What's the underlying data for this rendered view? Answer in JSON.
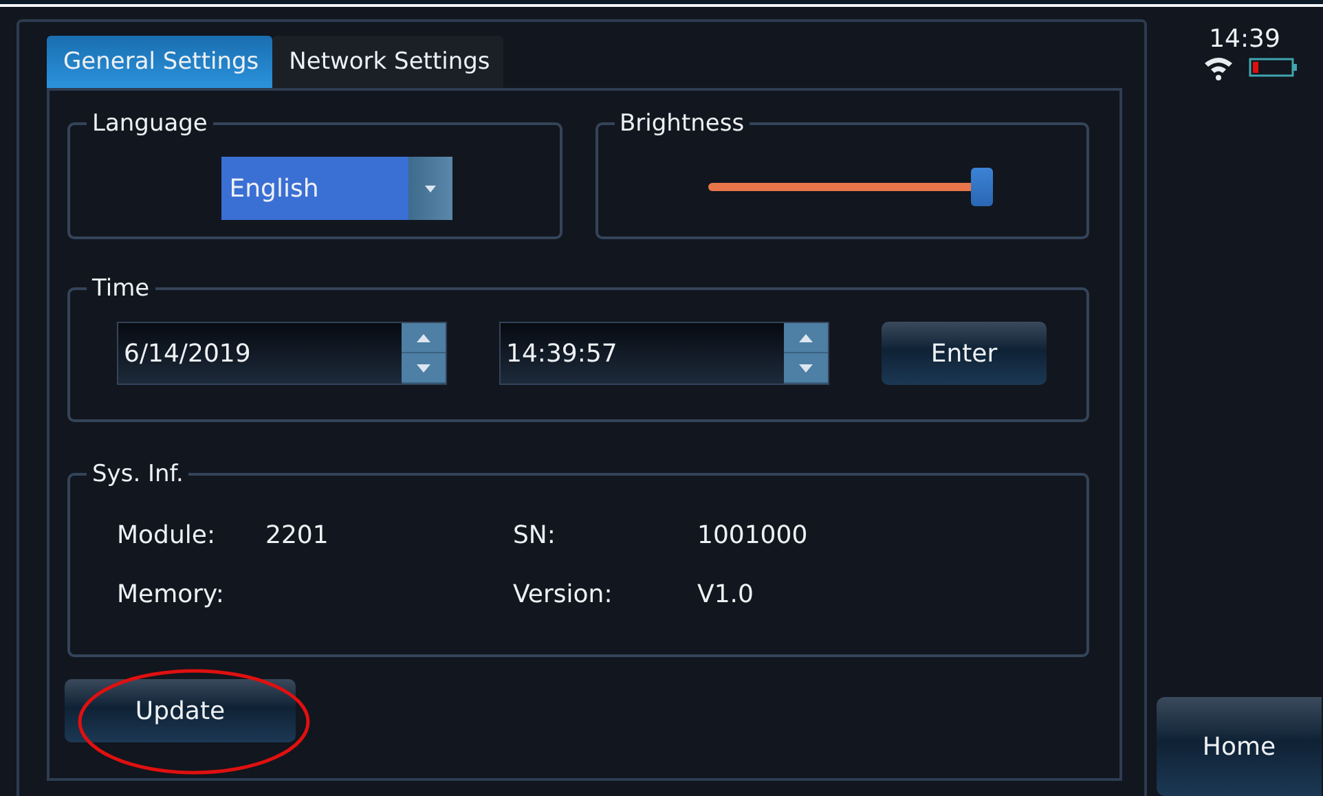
{
  "tabs": [
    {
      "label": "General Settings",
      "selected": true
    },
    {
      "label": "Network Settings",
      "selected": false
    }
  ],
  "language": {
    "title": "Language",
    "value": "English"
  },
  "brightness": {
    "title": "Brightness",
    "level": 0.97
  },
  "time": {
    "title": "Time",
    "date": "6/14/2019",
    "clock": "14:39:57",
    "button": "Enter"
  },
  "system_info": {
    "title": "Sys. Inf.",
    "fields": [
      {
        "label": "Module:",
        "value": "2201"
      },
      {
        "label": "SN:",
        "value": "1001000"
      },
      {
        "label": "Memory:"
      },
      {
        "label": "Version:",
        "value": "V1.0"
      }
    ]
  },
  "update_button": {
    "label": "Update",
    "highlighted": true
  },
  "status": {
    "time": "14:39"
  },
  "home_button": "Home"
}
